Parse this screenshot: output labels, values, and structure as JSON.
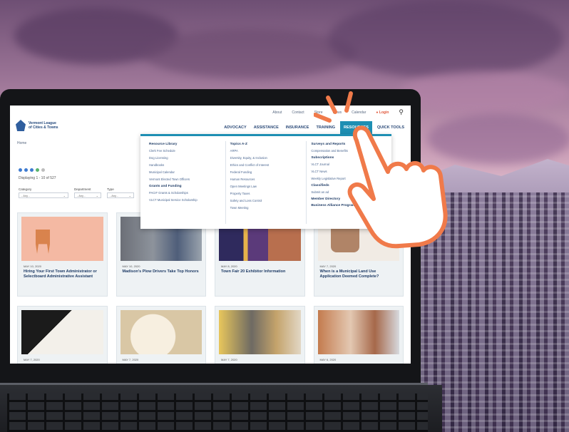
{
  "site": {
    "org_name_line1": "Vermont League",
    "org_name_line2": "of Cities & Towns"
  },
  "topbar": {
    "links": [
      "About",
      "Contact",
      "Store",
      "News",
      "Calendar"
    ],
    "login": "Login"
  },
  "mainnav": {
    "items": [
      "ADVOCACY",
      "ASSISTANCE",
      "INSURANCE",
      "TRAINING",
      "RESOURCES",
      "QUICK TOOLS"
    ],
    "active": "RESOURCES"
  },
  "breadcrumb": "Home",
  "filters": {
    "title": "Displaying 1 - 10 of 527",
    "category": {
      "label": "Category",
      "value": "- Any -"
    },
    "department": {
      "label": "Department",
      "value": "- Any -"
    },
    "type": {
      "label": "Type",
      "value": "- Any -"
    }
  },
  "mega_menu": {
    "col1": {
      "head1": "Resource Library",
      "links1": [
        "Clerk Fee Schedule",
        "Dog Licensing",
        "Handbooks",
        "Municipal Calendar",
        "Vermont Elected Town Officers"
      ],
      "head2": "Grants and Funding",
      "links2": [
        "PACIF Grants & Scholarships",
        "VLCT Municipal Service Scholarship"
      ]
    },
    "col2": {
      "head1": "Topics A-Z",
      "links1": [
        "ARPA",
        "Diversity, Equity, & Inclusion",
        "Ethics and Conflict of Interest",
        "Federal Funding",
        "Human Resources",
        "Open Meetings Law",
        "Property Taxes",
        "Safety and Loss Control",
        "Town Meeting"
      ]
    },
    "col3": {
      "head1": "Surveys and Reports",
      "links1": [
        "Compensation and Benefits"
      ],
      "head2": "Subscriptions",
      "links2": [
        "VLCT Journal",
        "VLCT News",
        "Weekly Legislative Report"
      ],
      "head3": "Classifieds",
      "links3": [
        "Submit an ad"
      ],
      "head4": "Member Directory",
      "head5": "Business Alliance Program"
    }
  },
  "cards": [
    {
      "date": "MAY 10, 2020",
      "title": "Hiring Your First Town Administrator or Selectboard Administrative Assistant"
    },
    {
      "date": "MAY 10, 2020",
      "title": "Madison's Plow Drivers Take Top Honors"
    },
    {
      "date": "MAY 8, 2020",
      "title": "Town Fair 20 Exhibitor Information"
    },
    {
      "date": "MAY 7, 2020",
      "title": "When is a Municipal Land Use Application Deemed Complete?"
    },
    {
      "date": "MAY 7, 2020",
      "title": ""
    },
    {
      "date": "MAY 7, 2020",
      "title": ""
    },
    {
      "date": "MAY 7, 2020",
      "title": ""
    },
    {
      "date": "MAY 6, 2020",
      "title": ""
    }
  ]
}
